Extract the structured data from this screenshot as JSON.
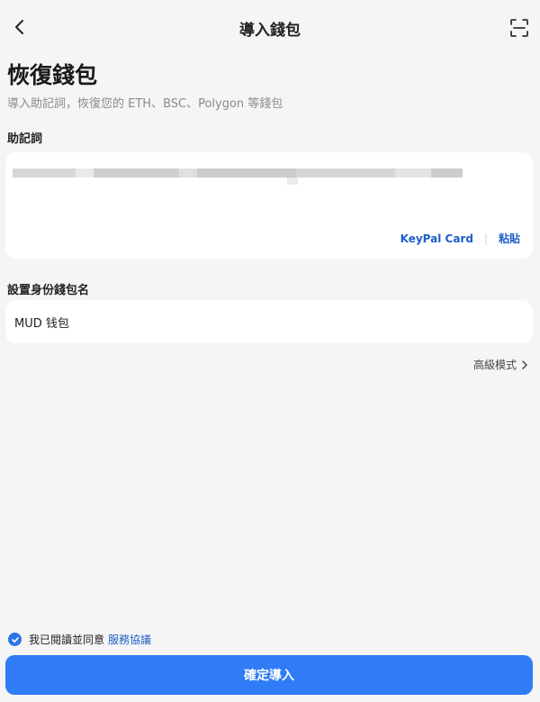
{
  "nav": {
    "title": "導入錢包",
    "back_icon": "chevron-left-icon",
    "scan_icon": "scan-icon"
  },
  "header": {
    "title": "恢復錢包",
    "subtitle": "導入助記詞，恢復您的 ETH、BSC、Polygon 等錢包"
  },
  "mnemonic": {
    "label": "助記詞",
    "keypal_label": "KeyPal Card",
    "separator": "|",
    "paste_label": "粘貼"
  },
  "wallet_name": {
    "label": "設置身份錢包名",
    "value": "MUD 钱包"
  },
  "advanced": {
    "label": "高級模式"
  },
  "agreement": {
    "text": "我已閱讀並同意",
    "link": "服務協議"
  },
  "confirm": {
    "label": "確定導入"
  },
  "colors": {
    "accent": "#2f7cf6",
    "link": "#1e5ec8",
    "background": "#f5f5f5"
  }
}
